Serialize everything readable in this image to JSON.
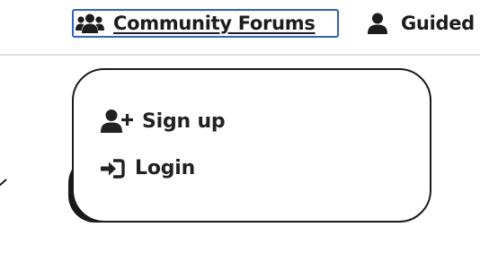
{
  "nav": {
    "items": [
      {
        "label": "Community Forums",
        "icon": "users-icon",
        "focused": true
      },
      {
        "label": "Guided",
        "icon": "user-icon"
      }
    ],
    "focus_ring_color": "#2b5fd9"
  },
  "dropdown": {
    "items": [
      {
        "label": "Sign up",
        "icon": "user-plus-icon"
      },
      {
        "label": "Login",
        "icon": "sign-in-icon"
      }
    ]
  }
}
